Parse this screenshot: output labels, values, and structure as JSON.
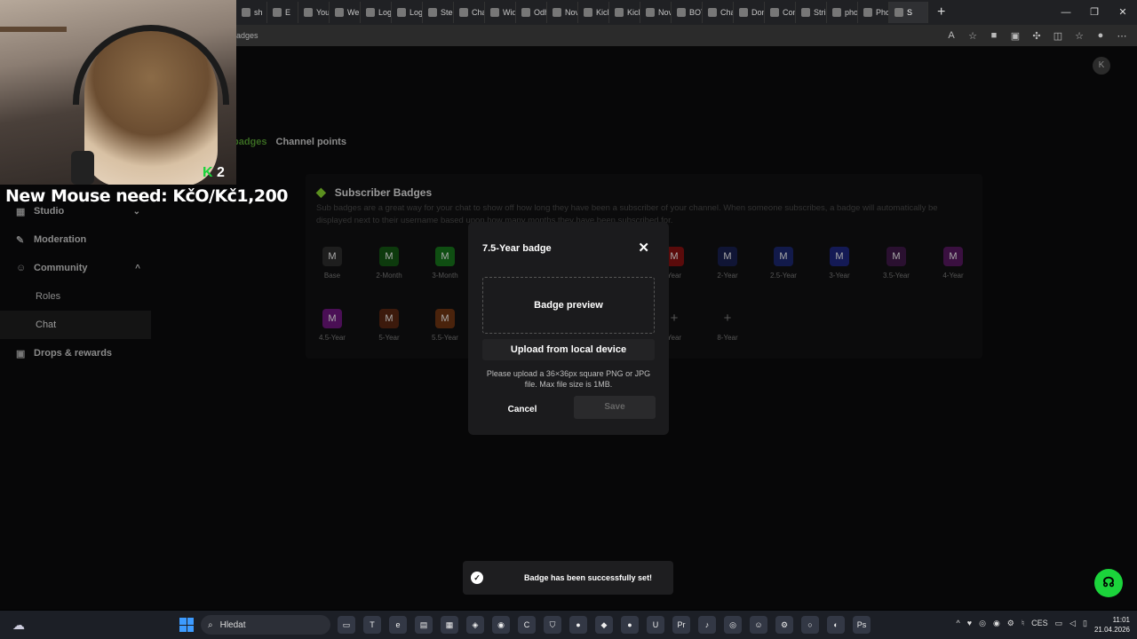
{
  "browser": {
    "tabs": [
      {
        "label": "sh"
      },
      {
        "label": "E"
      },
      {
        "label": "Youn"
      },
      {
        "label": "Webi"
      },
      {
        "label": "Logi"
      },
      {
        "label": "Logi"
      },
      {
        "label": "Steel"
      },
      {
        "label": "Chat"
      },
      {
        "label": "Widg"
      },
      {
        "label": "Odhu"
      },
      {
        "label": "Nov"
      },
      {
        "label": "Kick"
      },
      {
        "label": "Kick"
      },
      {
        "label": "Nov"
      },
      {
        "label": "BOT"
      },
      {
        "label": "Chat"
      },
      {
        "label": "Dono"
      },
      {
        "label": "Conf"
      },
      {
        "label": "Strip"
      },
      {
        "label": "photo"
      },
      {
        "label": "Phot"
      },
      {
        "label": "S",
        "active": true
      }
    ],
    "new_tab": "+",
    "url_fragment": "adges"
  },
  "page": {
    "tabs": {
      "badges": "badges",
      "channel_points": "Channel points"
    },
    "sidebar": [
      {
        "label": "Studio",
        "icon": "studio-icon",
        "type": "section",
        "chevron": "⌄"
      },
      {
        "label": "Moderation",
        "icon": "wrench-icon",
        "type": "section"
      },
      {
        "label": "Community",
        "icon": "community-icon",
        "type": "section",
        "chevron": "^"
      },
      {
        "label": "Roles",
        "type": "sub"
      },
      {
        "label": "Chat",
        "type": "sub",
        "active": true
      },
      {
        "label": "Drops & rewards",
        "icon": "gift-icon",
        "type": "section"
      }
    ],
    "panel": {
      "title": "Subscriber Badges",
      "description": "Sub badges are a great way for your chat to show off how long they have been a subscriber of your channel. When someone subscribes, a badge will automatically be displayed next to their username based upon how many months they have been subscribed for.",
      "badges_row1": [
        {
          "label": "Base",
          "color": "#1e1e1e"
        },
        {
          "label": "2-Month",
          "color": "#0d3a0d"
        },
        {
          "label": "3-Month",
          "color": "#0f4e12"
        },
        {
          "label": "Year",
          "color": "#5a0b0b"
        },
        {
          "label": "2-Year",
          "color": "#101535"
        },
        {
          "label": "2.5-Year",
          "color": "#121a4a"
        },
        {
          "label": "3-Year",
          "color": "#141a55"
        },
        {
          "label": "3.5-Year",
          "color": "#2a1030"
        },
        {
          "label": "4-Year",
          "color": "#3a1040"
        }
      ],
      "badges_row2": [
        {
          "label": "4.5-Year",
          "color": "#4a0f55"
        },
        {
          "label": "5-Year",
          "color": "#3c1a0c"
        },
        {
          "label": "5.5-Year",
          "color": "#4a230c"
        },
        {
          "label": "Year",
          "color": "",
          "add": true
        },
        {
          "label": "8-Year",
          "color": "",
          "add": true
        }
      ]
    }
  },
  "dialog": {
    "title": "7.5-Year badge",
    "close": "✕",
    "preview": "Badge preview",
    "upload": "Upload from local device",
    "help": "Please upload a 36×36px square PNG or JPG file. Max file size is 1MB.",
    "cancel": "Cancel",
    "save": "Save"
  },
  "toast": {
    "text": "Badge has been successfully set!",
    "check": "✓"
  },
  "webcam": {
    "overlay_text": "New Mouse need: KčO/Kč1,200",
    "counter": "2"
  },
  "taskbar": {
    "search_placeholder": "Hledat",
    "language": "CES",
    "time": "11:01",
    "date": "21.04.2026"
  },
  "colors": {
    "accent": "#1bd43b",
    "dialog_bg": "#1b1b1d"
  }
}
